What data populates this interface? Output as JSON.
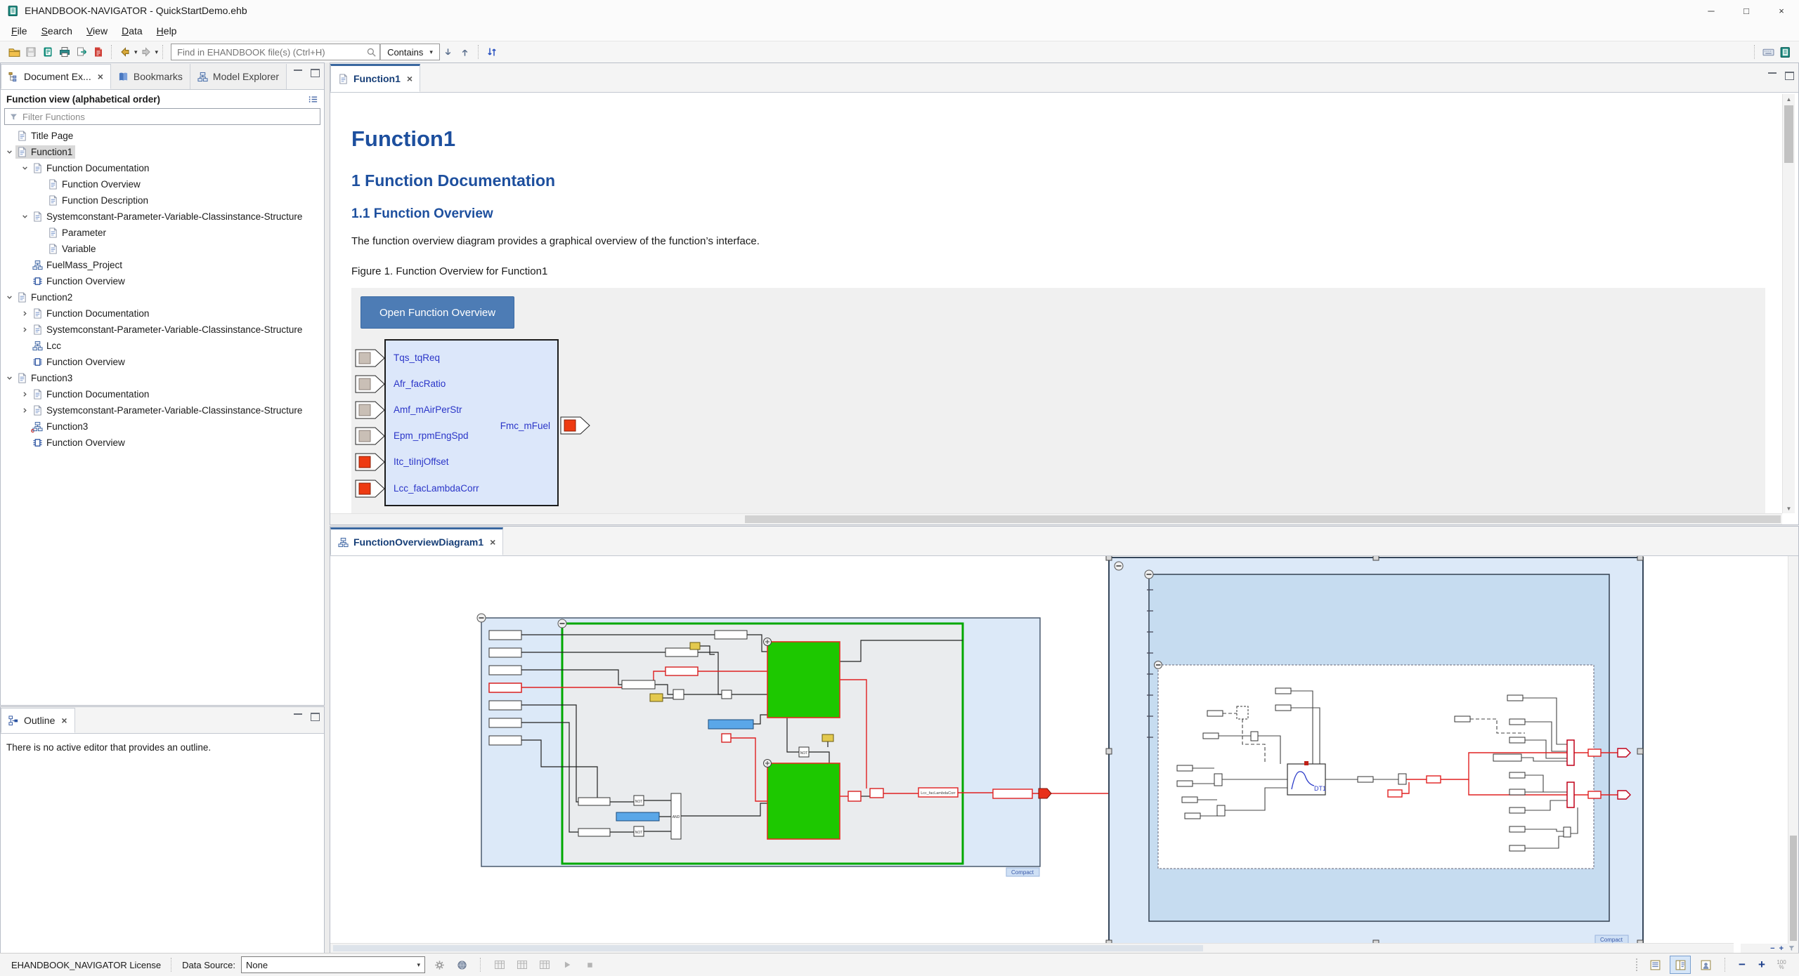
{
  "window": {
    "title": "EHANDBOOK-NAVIGATOR - QuickStartDemo.ehb",
    "minimize_glyph": "─",
    "maximize_glyph": "□",
    "close_glyph": "×"
  },
  "menu": {
    "items": [
      {
        "hot": "F",
        "rest": "ile"
      },
      {
        "hot": "S",
        "rest": "earch"
      },
      {
        "hot": "V",
        "rest": "iew"
      },
      {
        "hot": "D",
        "rest": "ata"
      },
      {
        "hot": "H",
        "rest": "elp"
      }
    ]
  },
  "toolbar": {
    "search_placeholder": "Find in EHANDBOOK file(s) (Ctrl+H)",
    "contains_label": "Contains",
    "caret": "▾",
    "icons": [
      "open-file",
      "save",
      "open-handbook",
      "print",
      "export-document",
      "export-pdf",
      "back",
      "forward",
      "search",
      "find-next",
      "find-previous",
      "sync-model",
      "keyboard-shortcuts",
      "app-logo"
    ]
  },
  "explorer": {
    "tabs": [
      {
        "label": "Document Ex..."
      },
      {
        "label": "Bookmarks"
      },
      {
        "label": "Model Explorer"
      }
    ],
    "header": "Function view (alphabetical order)",
    "filter_placeholder": "Filter Functions",
    "tree": [
      {
        "label": "Title Page"
      },
      {
        "label": "Function1"
      },
      {
        "label": "Function Documentation"
      },
      {
        "label": "Function Overview"
      },
      {
        "label": "Function Description"
      },
      {
        "label": "Systemconstant-Parameter-Variable-Classinstance-Structure"
      },
      {
        "label": "Parameter"
      },
      {
        "label": "Variable"
      },
      {
        "label": "FuelMass_Project"
      },
      {
        "label": "Function Overview"
      },
      {
        "label": "Function2"
      },
      {
        "label": "Function Documentation"
      },
      {
        "label": "Systemconstant-Parameter-Variable-Classinstance-Structure"
      },
      {
        "label": "Lcc"
      },
      {
        "label": "Function Overview"
      },
      {
        "label": "Function3"
      },
      {
        "label": "Function Documentation"
      },
      {
        "label": "Systemconstant-Parameter-Variable-Classinstance-Structure"
      },
      {
        "label": "Function3"
      },
      {
        "label": "Function Overview"
      }
    ]
  },
  "outline": {
    "tab": "Outline",
    "message": "There is no active editor that provides an outline."
  },
  "editor": {
    "tab": "Function1",
    "title": "Function1",
    "section1": "1 Function Documentation",
    "section11": "1.1 Function Overview",
    "body": "The function overview diagram provides a graphical overview of the function’s interface.",
    "caption": "Figure 1. Function Overview for Function1",
    "open_button": "Open Function Overview",
    "figure": {
      "inputs": [
        "Tqs_tqReq",
        "Afr_facRatio",
        "Amf_mAirPerStr",
        "Epm_rpmEngSpd",
        "Itc_tiInjOffset",
        "Lcc_facLambdaCorr"
      ],
      "output": "Fmc_mFuel"
    }
  },
  "diagram": {
    "tab": "FunctionOverviewDiagram1",
    "compact_badge": "Compact",
    "not_label": "NOT",
    "and_label": "AND",
    "dt_label": "DT1",
    "signal_label": "Lcc_facLambdaCorr"
  },
  "statusbar": {
    "license": "EHANDBOOK_NAVIGATOR License",
    "datasource_label": "Data Source:",
    "datasource_value": "None",
    "caret": "▾",
    "zoom_minus": "−",
    "zoom_plus": "+",
    "zoom_pct_top": "100",
    "zoom_pct_bottom": "%"
  },
  "scroll": {
    "up": "▲",
    "down": "▼"
  },
  "colors": {
    "accent_heading": "#1d4f9e",
    "button": "#4d7cb5",
    "container_blue": "#dce9f8",
    "container_blue_mid": "#c6dcf0",
    "green_block": "#1dc800",
    "green_border": "#00a800",
    "wire_red": "#e02020",
    "port_red": "#ee3a12",
    "port_grey": "#c9bfb6",
    "selection_grey": "#d9d9d9"
  }
}
